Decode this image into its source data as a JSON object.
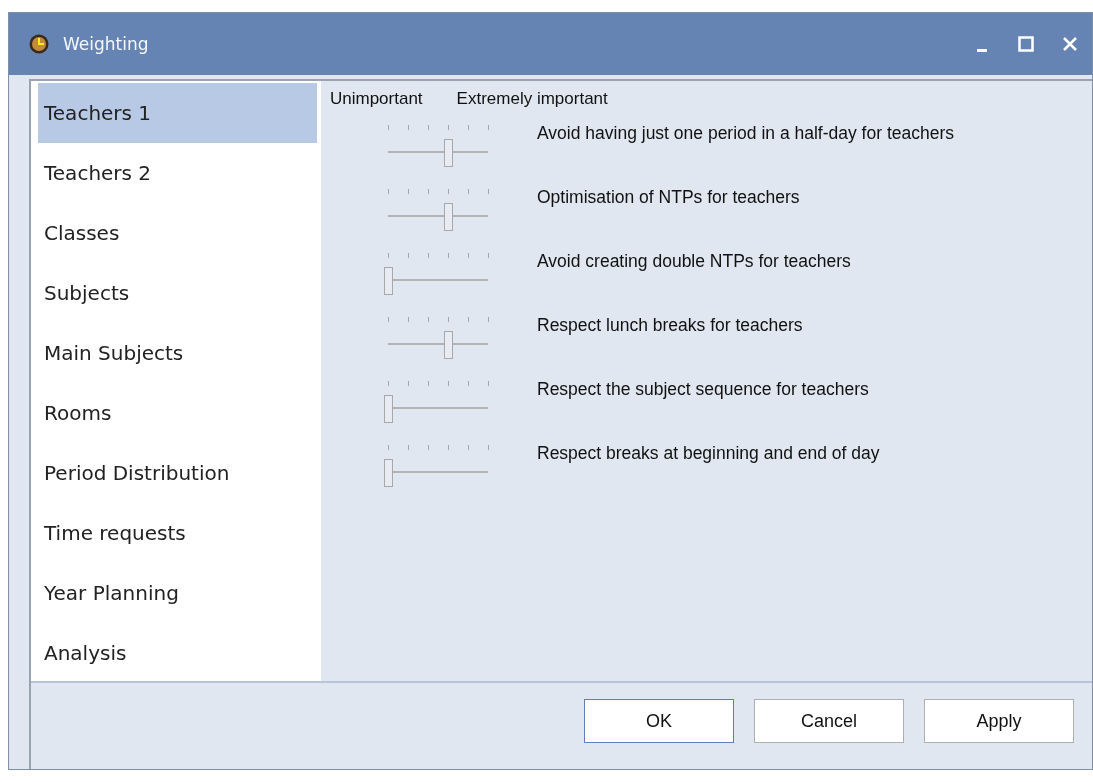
{
  "window": {
    "title": "Weighting"
  },
  "sidebar": {
    "items": [
      {
        "label": "Teachers 1",
        "selected": true
      },
      {
        "label": "Teachers 2",
        "selected": false
      },
      {
        "label": "Classes",
        "selected": false
      },
      {
        "label": "Subjects",
        "selected": false
      },
      {
        "label": "Main Subjects",
        "selected": false
      },
      {
        "label": "Rooms",
        "selected": false
      },
      {
        "label": "Period Distribution",
        "selected": false
      },
      {
        "label": "Time requests",
        "selected": false
      },
      {
        "label": "Year Planning",
        "selected": false
      },
      {
        "label": "Analysis",
        "selected": false
      }
    ]
  },
  "scale": {
    "low": "Unimportant",
    "high": "Extremely important"
  },
  "weights": [
    {
      "label": "Avoid having just one period in a half-day for teachers",
      "level": 0.6
    },
    {
      "label": "Optimisation of NTPs for teachers",
      "level": 0.6
    },
    {
      "label": "Avoid creating double NTPs for teachers",
      "level": 0
    },
    {
      "label": "Respect lunch breaks for teachers",
      "level": 0.6
    },
    {
      "label": "Respect the subject sequence for teachers",
      "level": 0
    },
    {
      "label": "Respect breaks at beginning and end of day",
      "level": 0
    }
  ],
  "buttons": [
    {
      "label": "OK",
      "default": true
    },
    {
      "label": "Cancel",
      "default": false
    },
    {
      "label": "Apply",
      "default": false
    }
  ]
}
